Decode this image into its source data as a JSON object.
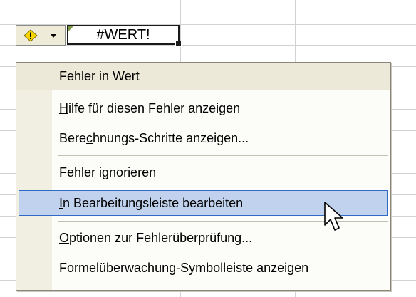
{
  "cell": {
    "value": "#WERT!"
  },
  "smart_tag": {
    "icon": "warning-icon",
    "dropdown_icon": "chevron-down-icon"
  },
  "menu": {
    "header": "Fehler in Wert",
    "items": [
      {
        "pre": "",
        "key": "H",
        "post": "ilfe für diesen Fehler anzeigen"
      },
      {
        "pre": "Bere",
        "key": "c",
        "post": "hnungs-Schritte anzeigen..."
      },
      {
        "pre": "Fehler i",
        "key": "g",
        "post": "norieren"
      },
      {
        "pre": "",
        "key": "I",
        "post": "n Bearbeitungsleiste bearbeiten"
      },
      {
        "pre": "",
        "key": "O",
        "post": "ptionen zur Fehlerüberprüfung..."
      },
      {
        "pre": "Formelüberwac",
        "key": "h",
        "post": "ung-Symbolleiste anzeigen"
      }
    ],
    "highlighted_index": 3
  },
  "colors": {
    "highlight_fill": "#c1d2ee",
    "highlight_border": "#316ac5",
    "menu_band": "#ece9d8",
    "warning": "#f5d300"
  }
}
